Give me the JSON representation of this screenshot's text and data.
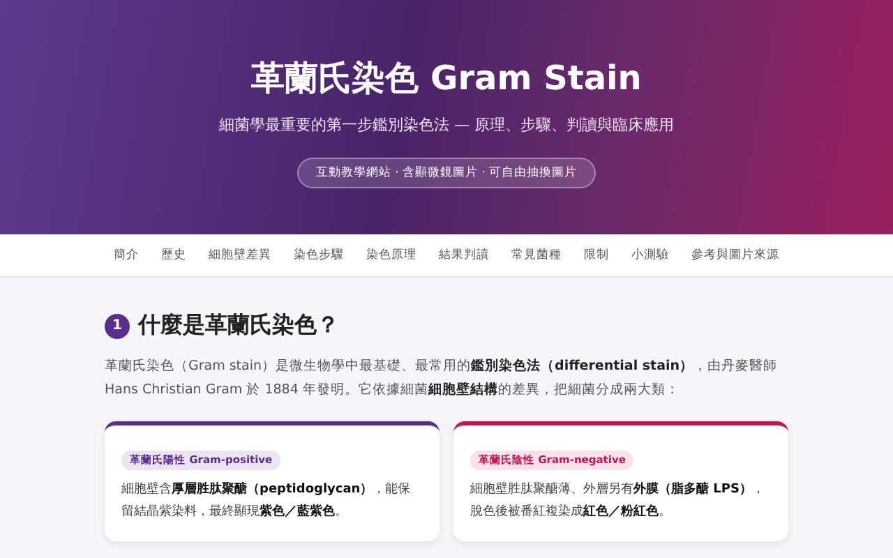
{
  "hero": {
    "title": "革蘭氏染色 Gram Stain",
    "subtitle": "細菌學最重要的第一步鑑別染色法 — 原理、步驟、判讀與臨床應用",
    "badge": "互動教學網站 · 含顯微鏡圖片 · 可自由抽換圖片"
  },
  "nav": {
    "items": [
      "簡介",
      "歷史",
      "細胞壁差異",
      "染色步驟",
      "染色原理",
      "結果判讀",
      "常見菌種",
      "限制",
      "小測驗",
      "參考與圖片來源"
    ]
  },
  "section": {
    "number": "1",
    "heading": "什麼是革蘭氏染色？",
    "paragraph": "革蘭氏染色（Gram stain）是微生物學中最基礎、最常用的**鑑別染色法（differential stain）**，由丹麥醫師 Hans Christian Gram 於 1884 年發明。它依據細菌**細胞壁結構**的差異，把細菌分成兩大類：",
    "cards": [
      {
        "tag": "革蘭氏陽性 Gram-positive",
        "color": "#5b2d8e",
        "text": "細胞壁含**厚層胜肽聚醣（peptidoglycan）**，能保留結晶紫染料，最終顯現**紫色／藍紫色**。"
      },
      {
        "tag": "革蘭氏陰性 Gram-negative",
        "color": "#c8134f",
        "text": "細胞壁胜肽聚醣薄、外層另有**外膜（脂多醣 LPS）**，脫色後被番紅複染成**紅色／粉紅色**。"
      }
    ]
  }
}
